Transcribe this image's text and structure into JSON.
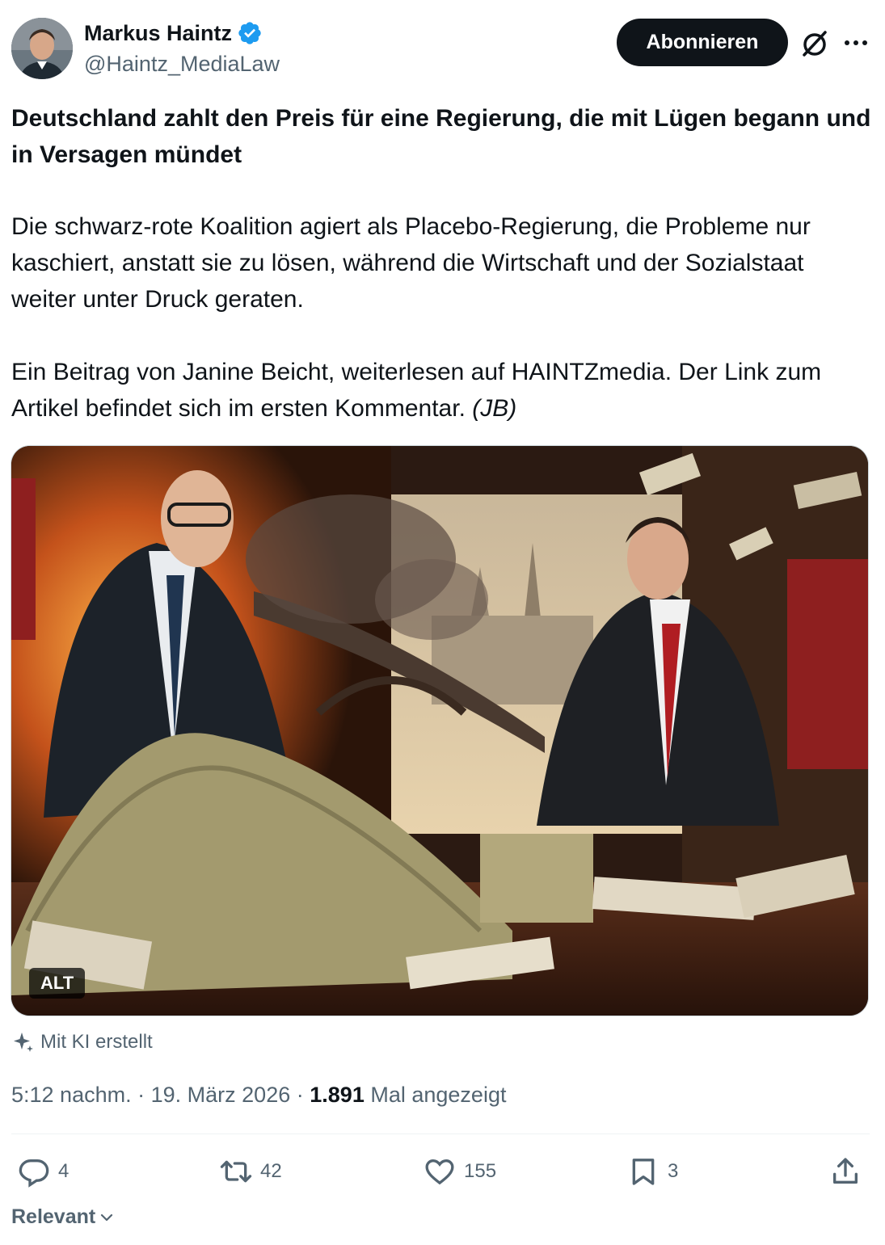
{
  "author": {
    "name": "Markus Haintz",
    "handle": "@Haintz_MediaLaw",
    "verified_color": "#1d9bf0"
  },
  "header": {
    "follow_label": "Abonnieren",
    "icons": [
      "grok-icon",
      "more-icon"
    ]
  },
  "post": {
    "headline": "Deutschland zahlt den Preis für eine Regierung, die mit Lügen begann und in Versagen mündet",
    "paragraph1": "Die schwarz-rote Koalition agiert als Placebo-Regierung, die Probleme nur kaschiert, anstatt sie zu lösen, während die Wirtschaft und der Sozialstaat weiter unter Druck geraten.",
    "paragraph2": "Ein Beitrag von Janine Beicht, weiterlesen auf HAINTZmedia. Der Link zum Artikel befindet sich im ersten Kommentar.",
    "paragraph2_italic": "(JB)"
  },
  "media": {
    "alt_label": "ALT",
    "ai_label": "Mit KI erstellt"
  },
  "meta": {
    "time": "5:12 nachm.",
    "separator": "·",
    "date": "19. März 2026",
    "views_count": "1.891",
    "views_label": "Mal angezeigt"
  },
  "actions": {
    "replies": "4",
    "reposts": "42",
    "likes": "155",
    "bookmarks": "3"
  },
  "sort": {
    "label": "Relevant"
  }
}
